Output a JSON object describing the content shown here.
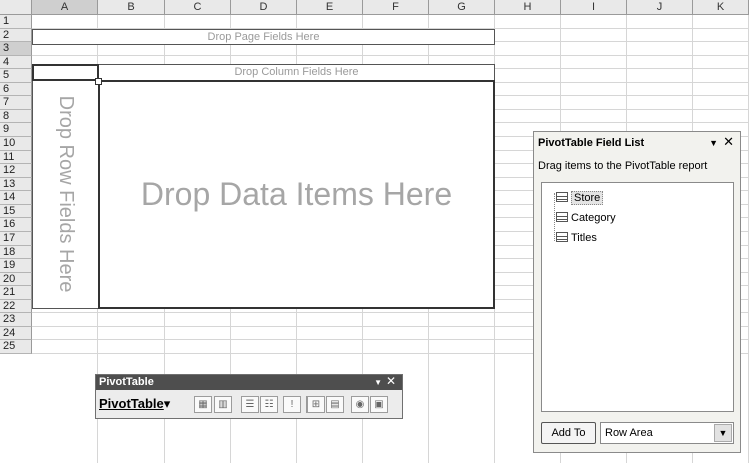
{
  "columns": [
    "A",
    "B",
    "C",
    "D",
    "E",
    "F",
    "G",
    "H",
    "I",
    "J",
    "K"
  ],
  "rows": [
    "1",
    "2",
    "3",
    "4",
    "5",
    "6",
    "7",
    "8",
    "9",
    "10",
    "11",
    "12",
    "13",
    "14",
    "15",
    "16",
    "17",
    "18",
    "19",
    "20",
    "21",
    "22",
    "23",
    "24",
    "25"
  ],
  "pivot": {
    "page_fields_label": "Drop Page Fields Here",
    "column_fields_label": "Drop Column Fields Here",
    "row_fields_label": "Drop Row Fields Here",
    "data_items_label": "Drop Data Items Here"
  },
  "field_list": {
    "title": "PivotTable Field List",
    "dropdown_glyph": "▼",
    "close_glyph": "✕",
    "instructions": "Drag items to the PivotTable report",
    "fields": [
      "Store",
      "Category",
      "Titles"
    ],
    "add_button": "Add To",
    "area_select": "Row Area",
    "area_arrow_glyph": "▼"
  },
  "toolbar": {
    "title": "PivotTable",
    "dropdown_glyph": "▼",
    "close_glyph": "✕",
    "menu_label": "PivotTable",
    "menu_arrow": "▾",
    "buttons": [
      {
        "name": "format-report-icon",
        "glyph": "▦"
      },
      {
        "name": "chart-wizard-icon",
        "glyph": "▥"
      },
      {
        "name": "hide-detail-icon",
        "glyph": "☰"
      },
      {
        "name": "show-detail-icon",
        "glyph": "☷"
      },
      {
        "name": "refresh-data-icon",
        "glyph": "!"
      },
      {
        "name": "include-hidden-items-icon",
        "glyph": "⊞"
      },
      {
        "name": "always-display-items-icon",
        "glyph": "▤"
      },
      {
        "name": "field-settings-icon",
        "glyph": "◉"
      },
      {
        "name": "show-field-list-icon",
        "glyph": "▣"
      }
    ]
  }
}
